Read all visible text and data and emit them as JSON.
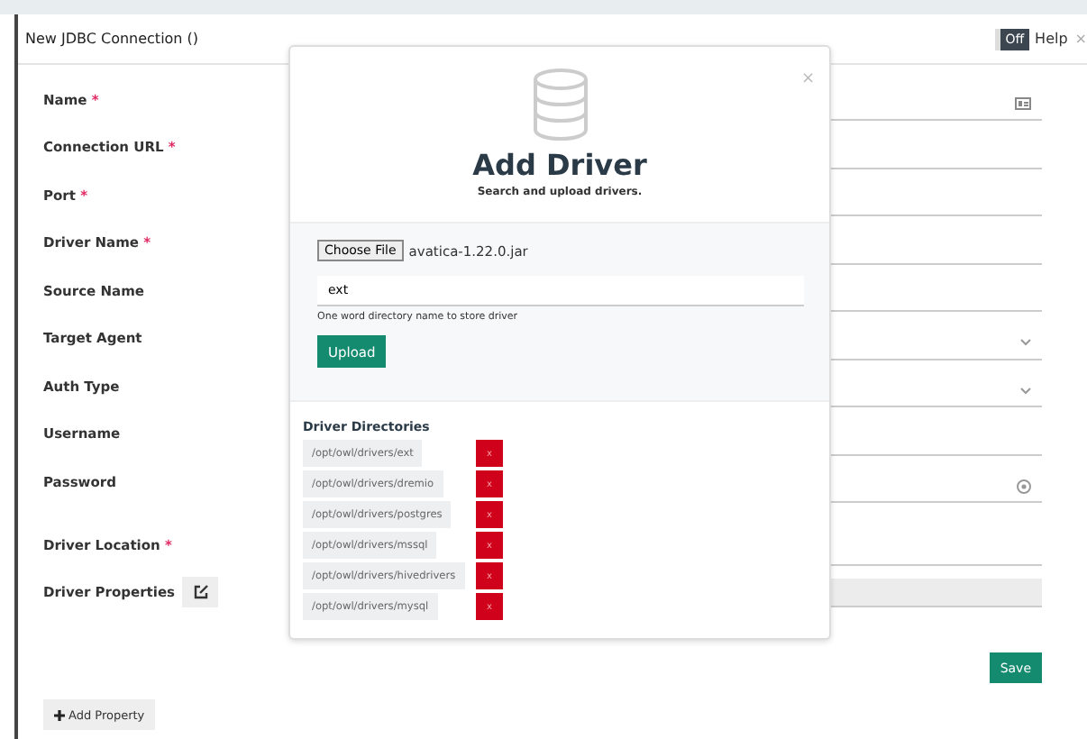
{
  "header": {
    "title": "New JDBC Connection ()",
    "toggle": {
      "label": "Off",
      "on": false
    },
    "help": "Help",
    "close": "×"
  },
  "fields": [
    {
      "label": "Name",
      "required_mark": "*",
      "kind": "card"
    },
    {
      "label": "Connection URL",
      "required_mark": "*",
      "kind": "text"
    },
    {
      "label": "Port",
      "required_mark": "*",
      "kind": "text"
    },
    {
      "label": "Driver Name",
      "required_mark": "*",
      "kind": "text"
    },
    {
      "label": "Source Name",
      "kind": "text"
    },
    {
      "label": "Target Agent",
      "kind": "select"
    },
    {
      "label": "Auth Type",
      "kind": "select"
    },
    {
      "label": "Username",
      "kind": "text"
    },
    {
      "label": "Password",
      "kind": "password"
    },
    {
      "label": "Driver Location",
      "required_mark": "*",
      "kind": "text"
    },
    {
      "label": "Driver Properties",
      "kind": "properties"
    }
  ],
  "save": "Save",
  "add_property": "Add Property",
  "modal": {
    "title": "Add Driver",
    "subtitle": "Search and upload drivers.",
    "close": "×",
    "file_button": "Choose File",
    "file_name": "avatica-1.22.0.jar",
    "directory_value": "ext",
    "hint": "One word directory name to store driver",
    "upload": "Upload",
    "directories_title": "Driver Directories",
    "directories": [
      {
        "path": "/opt/owl/drivers/ext",
        "remove": "x"
      },
      {
        "path": "/opt/owl/drivers/dremio",
        "remove": "x"
      },
      {
        "path": "/opt/owl/drivers/postgres",
        "remove": "x"
      },
      {
        "path": "/opt/owl/drivers/mssql",
        "remove": "x"
      },
      {
        "path": "/opt/owl/drivers/hivedrivers",
        "remove": "x"
      },
      {
        "path": "/opt/owl/drivers/mysql",
        "remove": "x"
      }
    ]
  }
}
